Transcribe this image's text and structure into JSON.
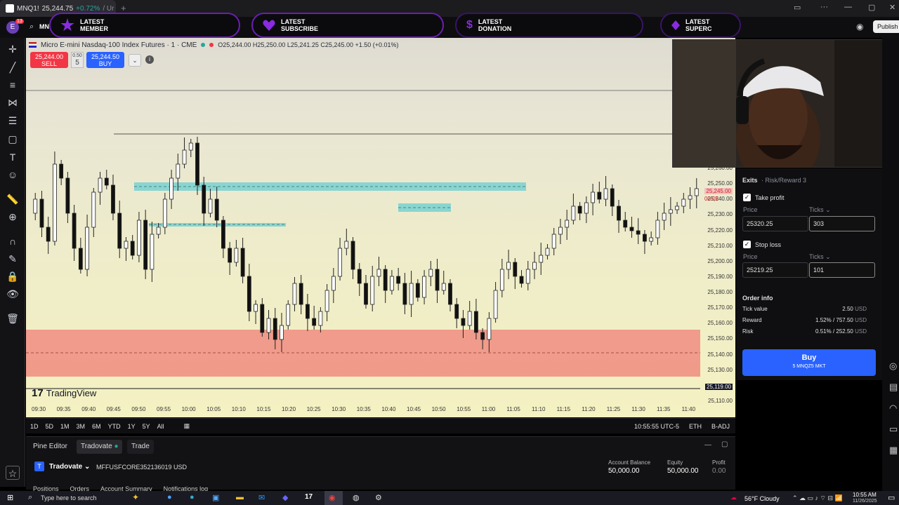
{
  "browser_tab": {
    "title": "MNQ1!",
    "price": "25,244.75",
    "change": "+0.72%",
    "suffix": "/ Ur"
  },
  "overlays": [
    {
      "line1": "LATEST",
      "line2": "MEMBER"
    },
    {
      "line1": "LATEST",
      "line2": "SUBSCRIBE"
    },
    {
      "line1": "LATEST",
      "line2": "DONATION"
    },
    {
      "line1": "LATEST",
      "line2": "SUPERC"
    }
  ],
  "header": {
    "avatar_letter": "E",
    "notif_count": "13",
    "ticker_short": "MN",
    "publish_label": "Publish"
  },
  "symbol": {
    "name": "Micro E-mini Nasdaq-100 Index Futures · 1 · CME",
    "ohlc": "O25,244.00 H25,250.00 L25,241.25 C25,245.00 +1.50 (+0.01%)"
  },
  "trade_buttons": {
    "sell_price": "25,244.00",
    "sell_label": "SELL",
    "spread_top": "0.50",
    "qty": "5",
    "buy_price": "25,244.50",
    "buy_label": "BUY"
  },
  "price_axis": [
    "25,260.00",
    "25,250.00",
    "25,245.00",
    "25,240.00",
    "25,230.00",
    "25,220.00",
    "25,210.00",
    "25,200.00",
    "25,190.00",
    "25,180.00",
    "25,170.00",
    "25,160.00",
    "25,150.00",
    "25,140.00",
    "25,130.00",
    "25,119.00",
    "25,110.00"
  ],
  "price_axis_highlight": {
    "price": "25,245.00",
    "countdown": "00:05"
  },
  "time_axis": [
    "09:30",
    "09:35",
    "09:40",
    "09:45",
    "09:50",
    "09:55",
    "10:00",
    "10:05",
    "10:10",
    "10:15",
    "10:20",
    "10:25",
    "10:30",
    "10:35",
    "10:40",
    "10:45",
    "10:50",
    "10:55",
    "11:00",
    "11:05",
    "11:10",
    "11:15",
    "11:20",
    "11:25",
    "11:30",
    "11:35",
    "11:40"
  ],
  "watermark": "TradingView",
  "range_buttons": [
    "1D",
    "5D",
    "1M",
    "3M",
    "6M",
    "YTD",
    "1Y",
    "5Y",
    "All"
  ],
  "status": {
    "clock": "10:55:55 UTC-5",
    "session": "ETH",
    "adj": "B-ADJ"
  },
  "bottom_tabs": [
    "Pine Editor",
    "Tradovate",
    "Trade"
  ],
  "broker": {
    "name": "Tradovate",
    "account": "MFFUSFCORE352136019 USD",
    "balance_label": "Account Balance",
    "balance": "50,000.00",
    "equity_label": "Equity",
    "equity": "50,000.00",
    "profit_label": "Profit",
    "profit": "0.00"
  },
  "account_tabs": [
    "Positions",
    "Orders",
    "Account Summary",
    "Notifications log"
  ],
  "order_panel": {
    "exits_label": "Exits",
    "rr_label": "Risk/Reward 3",
    "tp_label": "Take profit",
    "tp_price_label": "Price",
    "tp_ticks_label": "Ticks",
    "tp_price": "25320.25",
    "tp_ticks": "303",
    "sl_label": "Stop loss",
    "sl_price_label": "Price",
    "sl_ticks_label": "Ticks",
    "sl_price": "25219.25",
    "sl_ticks": "101",
    "info_title": "Order info",
    "tick_value_label": "Tick value",
    "tick_value": "2.50",
    "reward_label": "Reward",
    "reward": "1.52% / 757.50",
    "risk_label": "Risk",
    "risk": "0.51% / 252.50",
    "currency": "USD",
    "buy_label": "Buy",
    "buy_sub": "5 MNQZ5 MKT"
  },
  "taskbar": {
    "search_placeholder": "Type here to search",
    "weather": "56°F Cloudy",
    "time": "10:55 AM",
    "date": "11/26/2025"
  },
  "colors": {
    "bull": "#ffffff",
    "bear": "#111111",
    "zone_teal": "#7fd3d0",
    "zone_red": "#f08c80",
    "accent": "#2962ff"
  }
}
